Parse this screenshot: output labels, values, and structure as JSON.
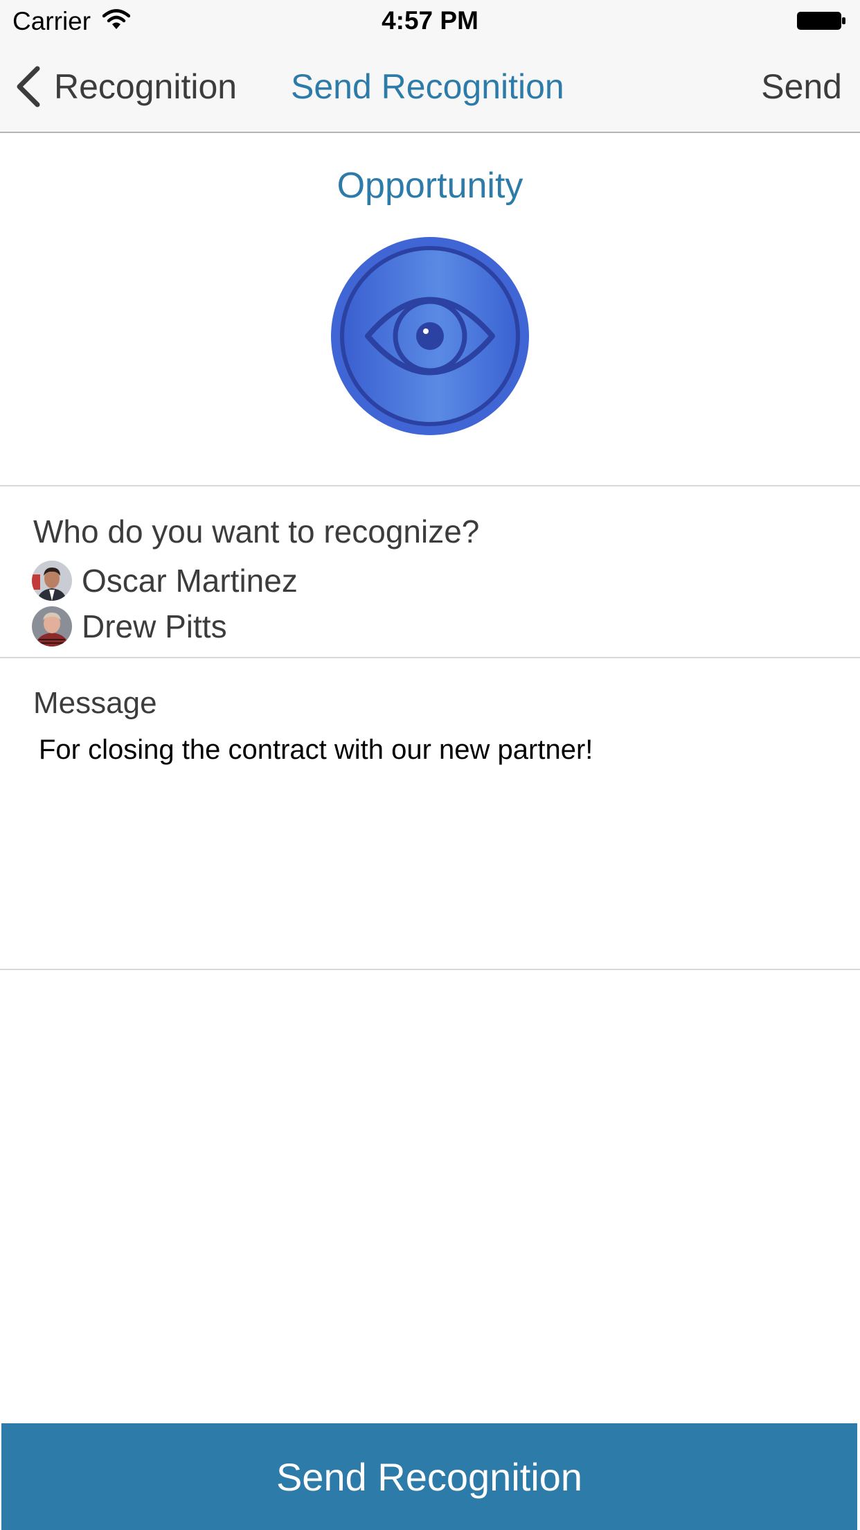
{
  "status_bar": {
    "carrier": "Carrier",
    "time": "4:57 PM",
    "wifi_icon": "wifi-icon",
    "battery_icon": "battery-full-icon"
  },
  "nav": {
    "back_label": "Recognition",
    "back_icon": "chevron-left-icon",
    "title": "Send Recognition",
    "send_label": "Send"
  },
  "badge": {
    "title": "Opportunity",
    "icon": "eye-badge-icon"
  },
  "recipients": {
    "label": "Who do you want to recognize?",
    "people": [
      {
        "name": "Oscar Martinez"
      },
      {
        "name": "Drew Pitts"
      }
    ]
  },
  "message": {
    "label": "Message",
    "text": "For closing the contract with our new partner!"
  },
  "bottom_button": {
    "label": "Send Recognition"
  },
  "colors": {
    "accent": "#2d7ba8",
    "badge_blue": "#3f6fd6",
    "nav_background": "#f7f7f7"
  }
}
